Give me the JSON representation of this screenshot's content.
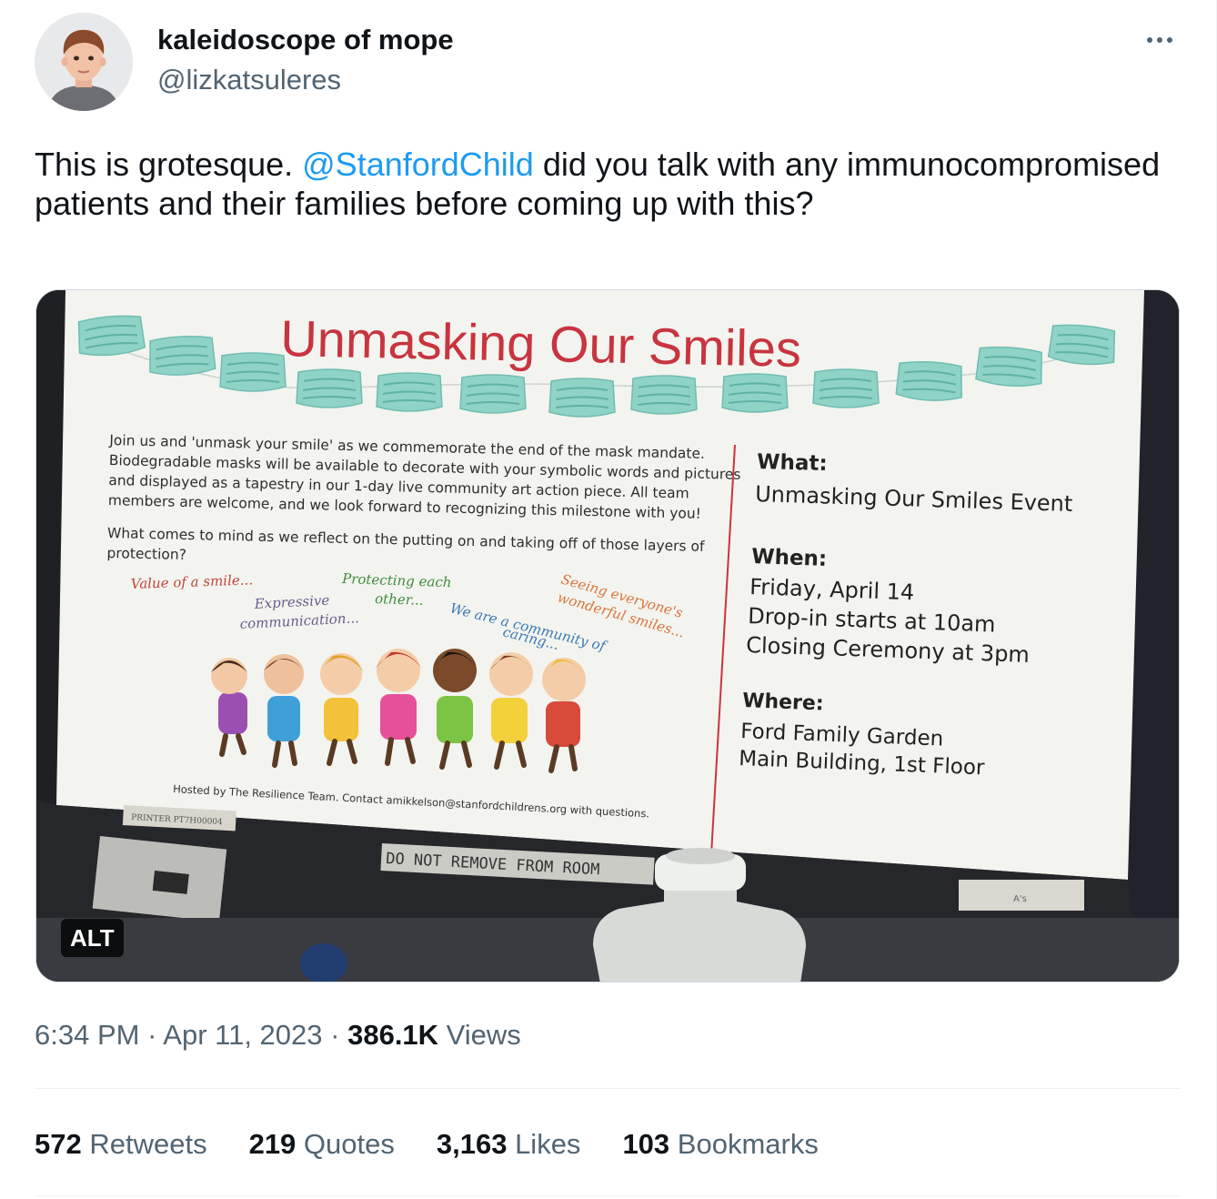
{
  "author": {
    "display_name": "kaleidoscope of mope",
    "handle": "@lizkatsuleres"
  },
  "tweet": {
    "text_before": "This is grotesque. ",
    "mention": "@StanfordChild",
    "text_after": " did you talk with any immunocompromised patients and their families before coming up with this?"
  },
  "media": {
    "alt_badge": "ALT",
    "flyer": {
      "title": "Unmasking Our Smiles",
      "body_lines": [
        "Join us and 'unmask your smile' as we commemorate the end of the mask mandate.",
        "Biodegradable masks will be available to decorate with your symbolic words and pictures",
        "and displayed as a tapestry in our 1-day live community art action piece. All team",
        "members are welcome, and we look forward to recognizing this milestone with you!"
      ],
      "question_lines": [
        "What comes to mind as we reflect on the putting on and taking off of those layers of",
        "protection?"
      ],
      "phrases": [
        "Value of a smile...",
        "Protecting each",
        "other...",
        "Seeing everyone's",
        "wonderful smiles...",
        "Expressive",
        "communication...",
        "We are a community of",
        "caring..."
      ],
      "what_label": "What:",
      "what_value": "Unmasking Our Smiles Event",
      "when_label": "When:",
      "when_lines": [
        "Friday, April 14",
        "Drop-in starts at 10am",
        "Closing Ceremony at 3pm"
      ],
      "where_label": "Where:",
      "where_lines": [
        "Ford Family Garden",
        "Main Building, 1st Floor"
      ],
      "footer_text": "Hosted by The Resilience Team. Contact amikkelson@stanfordchildrens.org with questions.",
      "printer_label": "PRINTER PT7H00004",
      "sticker_text": "DO NOT REMOVE FROM ROOM",
      "monitor_tag": "A's"
    },
    "colors": {
      "title_red": "#c8343f",
      "mask_teal": "#8fd3c7",
      "phrase_red": "#c0443a",
      "phrase_green": "#3f8a3c",
      "phrase_orange": "#d9743a",
      "phrase_blue": "#3b79b5",
      "phrase_purple": "#6b5b8f"
    }
  },
  "meta": {
    "time": "6:34 PM",
    "sep1": " · ",
    "date": "Apr 11, 2023",
    "sep2": " · ",
    "views_count": "386.1K",
    "views_label": " Views"
  },
  "stats": {
    "retweets_count": "572",
    "retweets_label": " Retweets",
    "quotes_count": "219",
    "quotes_label": " Quotes",
    "likes_count": "3,163",
    "likes_label": " Likes",
    "bookmarks_count": "103",
    "bookmarks_label": " Bookmarks"
  }
}
